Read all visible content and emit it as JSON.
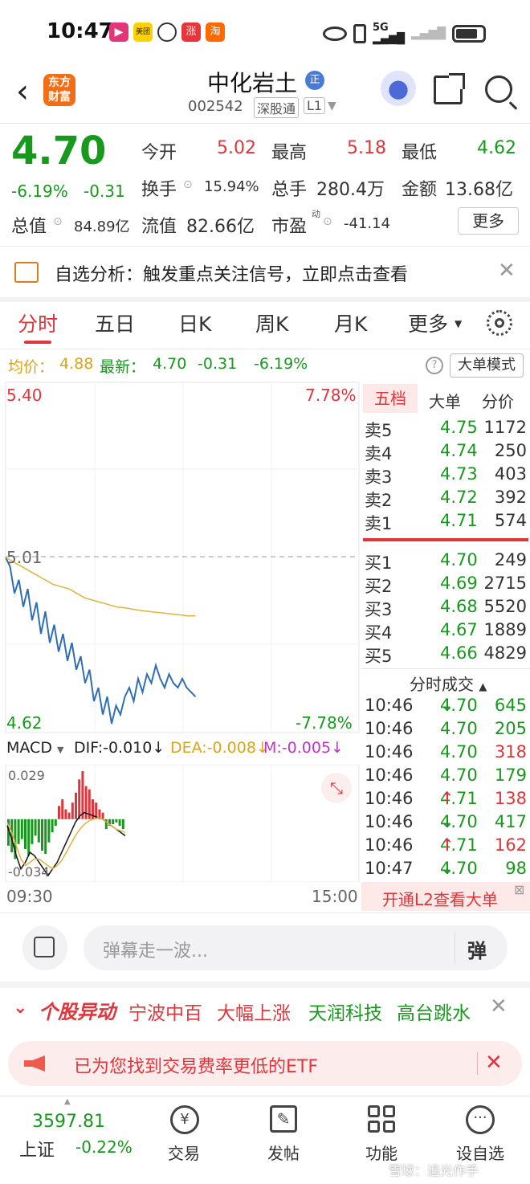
{
  "status_bar": {
    "time": "10:47",
    "network": "5G"
  },
  "header": {
    "app_badge": "东方财富",
    "stock_name": "中化岩土",
    "stock_code": "002542",
    "tag_exchange": "深股通",
    "tag_level": "L1"
  },
  "quote": {
    "price": "4.70",
    "change_pct": "-6.19%",
    "change": "-0.31",
    "open_label": "今开",
    "open_value": "5.02",
    "high_label": "最高",
    "high_value": "5.18",
    "low_label": "最低",
    "low_value": "4.62",
    "turnover_label": "换手",
    "turnover_value": "15.94%",
    "volume_label": "总手",
    "volume_value": "280.4万",
    "amount_label": "金额",
    "amount_value": "13.68亿",
    "mktcap_label": "总值",
    "mktcap_value": "84.89亿",
    "float_label": "流值",
    "float_value": "82.66亿",
    "pe_label": "市盈",
    "pe_sup": "动",
    "pe_value": "-41.14",
    "more_button": "更多"
  },
  "notice": {
    "text": "自选分析：触发重点关注信号，立即点击查看"
  },
  "tabs": [
    "分时",
    "五日",
    "日K",
    "周K",
    "月K",
    "更多"
  ],
  "chart_info": {
    "avg_label": "均价：",
    "avg_value": "4.88",
    "latest_label": "最新：",
    "latest_value": "4.70",
    "latest_change": "-0.31",
    "latest_pct": "-6.19%",
    "mode_button": "大单模式"
  },
  "chart_labels": {
    "top_price": "5.40",
    "top_pct": "7.78%",
    "ref_price": "5.01",
    "bottom_price": "4.62",
    "bottom_pct": "-7.78%",
    "macd_label": "MACD",
    "dif": "DIF:-0.010↓",
    "dea": "DEA:-0.008↓",
    "m": "M:-0.005↓",
    "macd_top": "0.029",
    "macd_bottom": "-0.034",
    "time_start": "09:30",
    "time_end": "15:00"
  },
  "chart_data": {
    "type": "line",
    "x_range": [
      "09:30",
      "15:00"
    ],
    "ylim": [
      4.62,
      5.4
    ],
    "prev_close": 5.01,
    "series": [
      {
        "values": [
          5.01,
          4.99,
          4.93,
          4.96,
          4.9,
          4.94,
          4.87,
          4.91,
          4.84,
          4.89,
          4.82,
          4.86,
          4.8,
          4.84,
          4.78,
          4.82,
          4.76,
          4.79,
          4.73,
          4.76,
          4.69,
          4.72,
          4.66,
          4.7,
          4.64,
          4.68,
          4.66,
          4.7,
          4.72,
          4.69,
          4.74,
          4.71,
          4.75,
          4.73,
          4.77,
          4.74,
          4.72,
          4.75,
          4.73,
          4.72,
          4.74,
          4.72,
          4.71,
          4.7
        ]
      },
      {
        "values": [
          5.01,
          5.0,
          4.99,
          4.98,
          4.97,
          4.96,
          4.95,
          4.945,
          4.94,
          4.93,
          4.92,
          4.915,
          4.91,
          4.905,
          4.9,
          4.898,
          4.895,
          4.892,
          4.89,
          4.888,
          4.886,
          4.884,
          4.882,
          4.88,
          4.88
        ]
      }
    ],
    "macd": {
      "ylim": [
        -0.034,
        0.029
      ],
      "bars": [
        -0.016,
        -0.02,
        -0.024,
        -0.015,
        -0.012,
        -0.018,
        -0.022,
        -0.015,
        -0.01,
        -0.014,
        -0.019,
        -0.021,
        -0.014,
        -0.008,
        -0.004,
        0.008,
        0.012,
        0.006,
        0.004,
        0.01,
        0.016,
        0.024,
        0.029,
        0.02,
        0.018,
        0.012,
        0.01,
        0.006,
        0.004,
        -0.006,
        -0.004,
        -0.003,
        -0.002,
        -0.004,
        -0.006
      ],
      "dif": [
        -0.004,
        -0.012,
        -0.022,
        -0.03,
        -0.026,
        -0.02,
        -0.022,
        -0.026,
        -0.03,
        -0.034,
        -0.03,
        -0.026,
        -0.02,
        -0.014,
        -0.008,
        -0.002,
        0.002,
        0.004,
        0.003,
        0.002,
        0.001,
        0.0,
        -0.002,
        -0.004,
        -0.006,
        -0.008,
        -0.01
      ],
      "dea": [
        -0.002,
        -0.008,
        -0.016,
        -0.024,
        -0.028,
        -0.026,
        -0.024,
        -0.024,
        -0.026,
        -0.028,
        -0.03,
        -0.028,
        -0.025,
        -0.02,
        -0.015,
        -0.01,
        -0.006,
        -0.003,
        -0.001,
        0.0,
        0.001,
        0.0,
        -0.002,
        -0.004,
        -0.006,
        -0.007,
        -0.008
      ]
    }
  },
  "orderbook": {
    "tabs": [
      "五档",
      "大单",
      "分价"
    ],
    "sells": [
      {
        "label": "卖5",
        "price": "4.75",
        "vol": "1172"
      },
      {
        "label": "卖4",
        "price": "4.74",
        "vol": "250"
      },
      {
        "label": "卖3",
        "price": "4.73",
        "vol": "403"
      },
      {
        "label": "卖2",
        "price": "4.72",
        "vol": "392"
      },
      {
        "label": "卖1",
        "price": "4.71",
        "vol": "574"
      }
    ],
    "buys": [
      {
        "label": "买1",
        "price": "4.70",
        "vol": "249"
      },
      {
        "label": "买2",
        "price": "4.69",
        "vol": "2715"
      },
      {
        "label": "买3",
        "price": "4.68",
        "vol": "5520"
      },
      {
        "label": "买4",
        "price": "4.67",
        "vol": "1889"
      },
      {
        "label": "买5",
        "price": "4.66",
        "vol": "4829"
      }
    ]
  },
  "trades": {
    "title": "分时成交",
    "rows": [
      {
        "time": "10:46",
        "price": "4.70",
        "dir": "↓",
        "vol": "645"
      },
      {
        "time": "10:46",
        "price": "4.70",
        "dir": "",
        "vol": "205"
      },
      {
        "time": "10:46",
        "price": "4.70",
        "dir": "",
        "vol": "318"
      },
      {
        "time": "10:46",
        "price": "4.70",
        "dir": "",
        "vol": "179"
      },
      {
        "time": "10:46",
        "price": "4.71",
        "dir": "↑",
        "vol": "138"
      },
      {
        "time": "10:46",
        "price": "4.70",
        "dir": "↓",
        "vol": "417"
      },
      {
        "time": "10:46",
        "price": "4.71",
        "dir": "↑",
        "vol": "162"
      },
      {
        "time": "10:47",
        "price": "4.70",
        "dir": "↓",
        "vol": "98"
      }
    ],
    "l2_banner": "开通L2查看大单"
  },
  "comment": {
    "placeholder": "弹幕走一波...",
    "danmu_button": "弹"
  },
  "movers": {
    "title": "个股异动",
    "items": [
      {
        "name": "宁波中百",
        "tag": "大幅上涨"
      },
      {
        "name": "天润科技",
        "tag": "高台跳水"
      }
    ]
  },
  "promo": {
    "text": "已为您找到交易费率更低的ETF"
  },
  "bottom_nav": {
    "index_value": "3597.81",
    "index_name": "上证",
    "index_change": "-0.22%",
    "items": [
      "交易",
      "发帖",
      "功能",
      "设自选"
    ]
  },
  "watermark": "雪球：追光作手"
}
